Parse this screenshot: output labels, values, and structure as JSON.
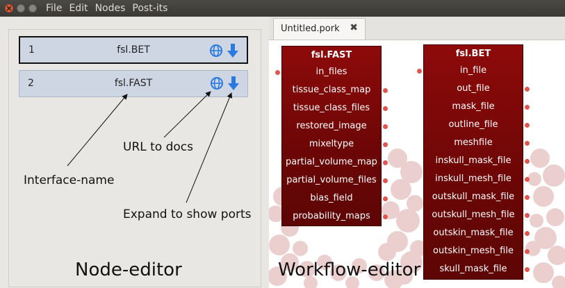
{
  "window": {
    "menu": [
      "File",
      "Edit",
      "Nodes",
      "Post-its"
    ]
  },
  "node_editor": {
    "nodes": [
      {
        "index": "1",
        "name": "fsl.BET",
        "selected": true
      },
      {
        "index": "2",
        "name": "fsl.FAST",
        "selected": false
      }
    ],
    "icons": [
      "globe-icon",
      "download-arrow-icon"
    ],
    "annotations": {
      "url_to_docs": "URL to docs",
      "interface_name": "Interface-name",
      "expand_ports": "Expand to show ports"
    },
    "title": "Node-editor"
  },
  "workflow_editor": {
    "tab_label": "Untitled.pork",
    "tab_close": "✖",
    "title": "Workflow-editor",
    "node_fast": {
      "title": "fsl.FAST",
      "input": "in_files",
      "outputs": [
        "tissue_class_map",
        "tissue_class_files",
        "restored_image",
        "mixeltype",
        "partial_volume_map",
        "partial_volume_files",
        "bias_field",
        "probability_maps"
      ]
    },
    "node_bet": {
      "title": "fsl.BET",
      "input": "in_file",
      "outputs": [
        "out_file",
        "mask_file",
        "outline_file",
        "meshfile",
        "inskull_mask_file",
        "inskull_mesh_file",
        "outskull_mask_file",
        "outskull_mesh_file",
        "outskin_mask_file",
        "outskin_mesh_file",
        "skull_mask_file"
      ]
    }
  },
  "colors": {
    "accent_blue": "#2a7ae2",
    "node_red": "#7a0707",
    "port_dot": "#e0554f",
    "row_blue": "#cdd6e2"
  }
}
